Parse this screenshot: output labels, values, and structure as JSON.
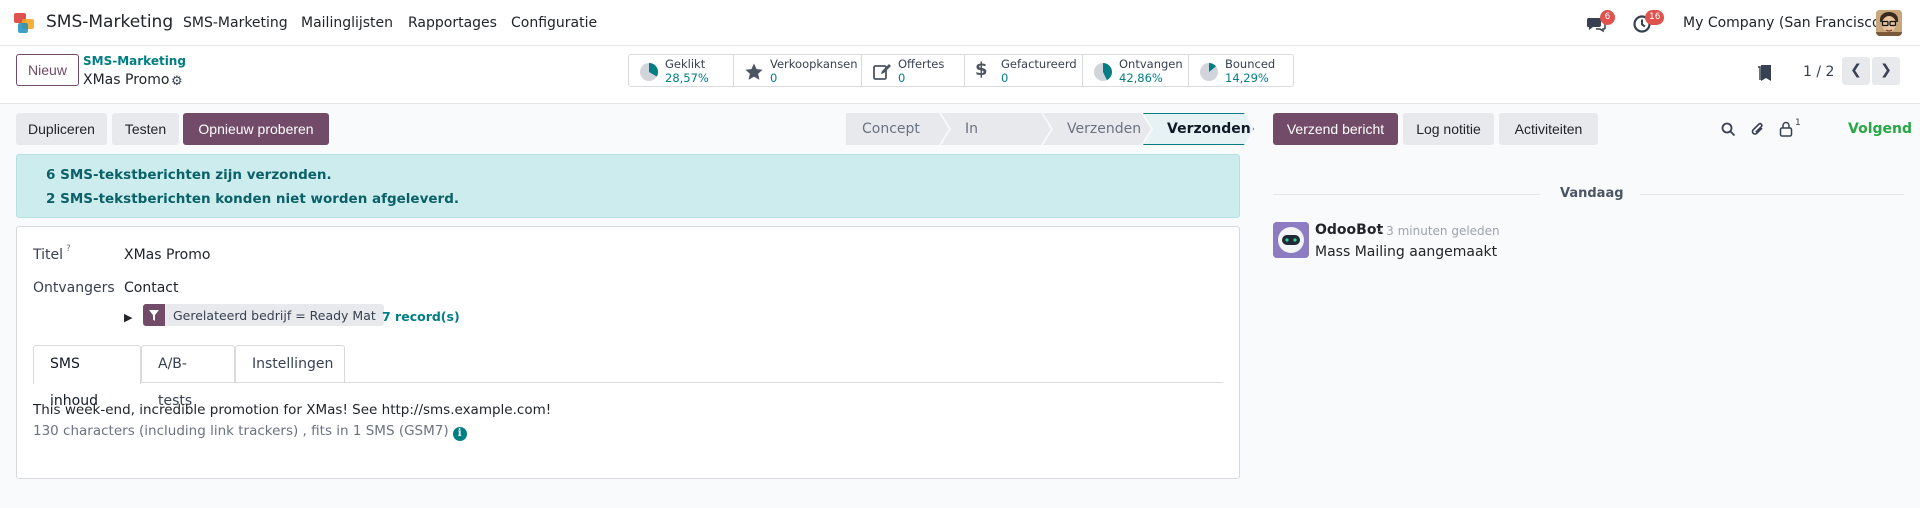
{
  "navbar": {
    "app_name": "SMS-Marketing",
    "menu": [
      "SMS-Marketing",
      "Mailinglijsten",
      "Rapportages",
      "Configuratie"
    ],
    "messages_count": "6",
    "activities_count": "16",
    "company": "My Company (San Francisco)"
  },
  "control_panel": {
    "new_button": "Nieuw",
    "breadcrumb_parent": "SMS-Marketing",
    "breadcrumb_current": "XMas Promo",
    "stats": [
      {
        "label": "Geklikt",
        "value": "28,57%"
      },
      {
        "label": "Verkoopkansen",
        "value": "0"
      },
      {
        "label": "Offertes",
        "value": "0"
      },
      {
        "label": "Gefactureerd",
        "value": "0"
      },
      {
        "label": "Ontvangen",
        "value": "42,86%"
      },
      {
        "label": "Bounced",
        "value": "14,29%"
      }
    ],
    "pager": "1 / 2"
  },
  "actions": {
    "duplicate": "Dupliceren",
    "test": "Testen",
    "retry": "Opnieuw proberen"
  },
  "status_stages": [
    "Concept",
    "In wachtrij",
    "Verzenden",
    "Verzonden"
  ],
  "active_stage": "Verzonden",
  "alert": {
    "line1": "6  SMS-tekstberichten zijn verzonden.",
    "line2": "2  SMS-tekstberichten konden niet worden afgeleverd."
  },
  "form": {
    "title_label": "Titel",
    "title_help": "?",
    "title_value": "XMas Promo",
    "recipients_label": "Ontvangers",
    "recipients_value": "Contact",
    "domain_filter": "Gerelateerd bedrijf = Ready Mat",
    "records_link": "7 record(s)",
    "tabs": [
      "SMS inhoud",
      "A/B-tests",
      "Instellingen"
    ],
    "active_tab": "SMS inhoud",
    "sms_body": "This week-end, incredible promotion for XMas! See http://sms.example.com!",
    "sms_info": "130 characters (including link trackers) , fits in 1 SMS (GSM7)"
  },
  "chatter": {
    "send_message": "Verzend bericht",
    "log_note": "Log notitie",
    "activities": "Activiteiten",
    "followers_count": "1",
    "follow": "Volgend",
    "date_separator": "Vandaag",
    "messages": [
      {
        "author": "OdooBot",
        "date": "- 3 minuten geleden",
        "body": "Mass Mailing aangemaakt"
      }
    ]
  },
  "colors": {
    "primary": "#714b67",
    "accent": "#017e84",
    "alert_bg": "#cdeced",
    "follow": "#28a745",
    "badge": "#e0524e"
  }
}
